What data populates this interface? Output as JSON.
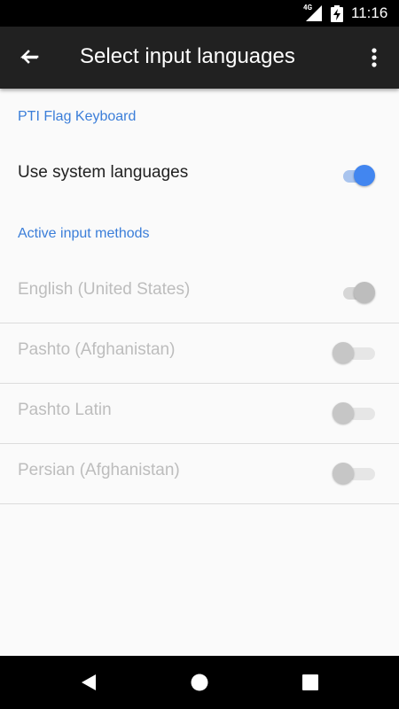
{
  "status_bar": {
    "network": "4G",
    "time": "11:16"
  },
  "app_bar": {
    "title": "Select input languages",
    "back_icon": "arrow-back-icon",
    "overflow_icon": "more-vert-icon"
  },
  "sections": [
    {
      "header": "PTI Flag Keyboard"
    },
    {
      "header": "Active input methods"
    }
  ],
  "use_system_languages": {
    "label": "Use system languages",
    "checked": true,
    "enabled": true
  },
  "input_methods": [
    {
      "label": "English (United States)",
      "checked": true,
      "enabled": false
    },
    {
      "label": "Pashto (Afghanistan)",
      "checked": false,
      "enabled": false
    },
    {
      "label": "Pashto Latin",
      "checked": false,
      "enabled": false
    },
    {
      "label": "Persian (Afghanistan)",
      "checked": false,
      "enabled": false
    }
  ],
  "colors": {
    "accent": "#4286f0",
    "section_header": "#3b7ed9",
    "app_bar": "#212121",
    "disabled_text": "#bdbdbd"
  },
  "nav_bar": {
    "back": "nav-back-icon",
    "home": "nav-home-icon",
    "recents": "nav-recents-icon"
  }
}
